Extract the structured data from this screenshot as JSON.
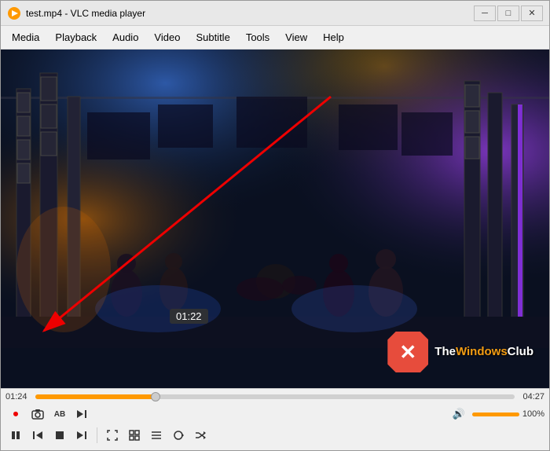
{
  "window": {
    "title": "test.mp4 - VLC media player",
    "icon": "▶"
  },
  "titlebar": {
    "minimize_label": "─",
    "maximize_label": "□",
    "close_label": "✕"
  },
  "menubar": {
    "items": [
      {
        "label": "Media",
        "id": "media"
      },
      {
        "label": "Playback",
        "id": "playback"
      },
      {
        "label": "Audio",
        "id": "audio"
      },
      {
        "label": "Video",
        "id": "video"
      },
      {
        "label": "Subtitle",
        "id": "subtitle"
      },
      {
        "label": "Tools",
        "id": "tools"
      },
      {
        "label": "View",
        "id": "view"
      },
      {
        "label": "Help",
        "id": "help"
      }
    ]
  },
  "player": {
    "current_time": "01:24",
    "total_time": "04:27",
    "tooltip_time": "01:22",
    "progress_pct": 25,
    "volume_pct": 100,
    "volume_label": "100%"
  },
  "controls_row1": {
    "record_btn": "⏺",
    "snapshot_btn": "📷",
    "ab_btn": "AB",
    "frame_next_btn": "⏭"
  },
  "controls_row2": {
    "play_pause_btn": "⏸",
    "prev_btn": "⏮",
    "stop_btn": "⏹",
    "next_btn": "⏭",
    "fullscreen_btn": "⛶",
    "extended_btn": "⊞",
    "playlist_btn": "≡",
    "loop_btn": "↺",
    "random_btn": "⤢"
  },
  "watermark": {
    "site": "TheWindowsClub"
  }
}
